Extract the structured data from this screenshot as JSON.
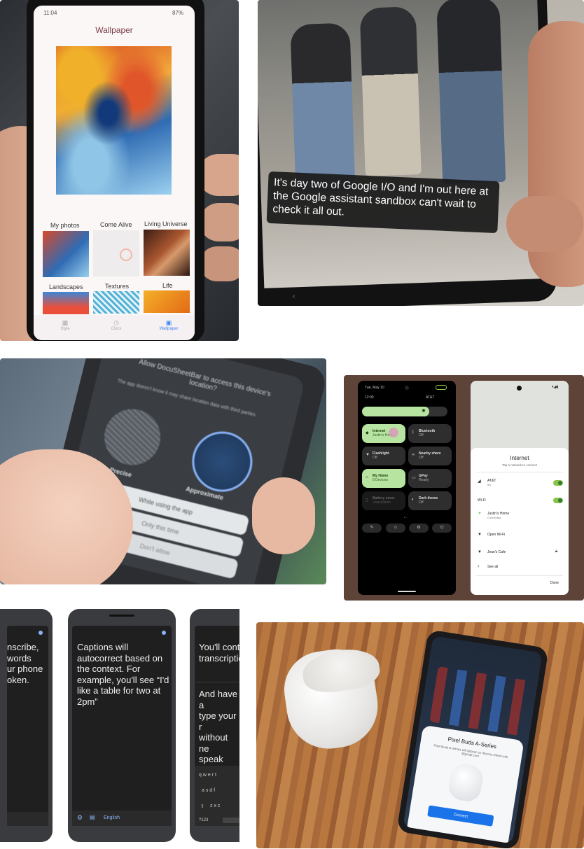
{
  "tile1": {
    "status_time": "11:04",
    "status_battery": "87%",
    "title": "Wallpaper",
    "categories": [
      "My photos",
      "Come Alive",
      "Living Universe",
      "Landscapes",
      "Textures",
      "Life"
    ],
    "nav": [
      "Style",
      "Clock",
      "Wallpaper"
    ]
  },
  "tile2": {
    "caption": "It's day two of Google I/O and I'm out here at the Google assistant sandbox can't wait to check it all out."
  },
  "tile3": {
    "dialog_title": "Allow DocuSheetBar to access this device's location?",
    "dialog_note": "The app doesn't know it may share location data with third parties",
    "precise": "Precise",
    "approximate": "Approximate",
    "options": [
      "While using the app",
      "Only this time",
      "Don't allow"
    ]
  },
  "tile4": {
    "left": {
      "date": "Tue, May 10",
      "time": "12:00",
      "carrier": "AT&T",
      "tiles": [
        {
          "title": "Internet",
          "sub": "Justin's Home"
        },
        {
          "title": "Bluetooth",
          "sub": "Off"
        },
        {
          "title": "Flashlight",
          "sub": "Off"
        },
        {
          "title": "Nearby share",
          "sub": "Off"
        },
        {
          "title": "My Home",
          "sub": "6 Devices"
        },
        {
          "title": "GPay",
          "sub": "Ready"
        },
        {
          "title": "Battery saver",
          "sub": "Unavailable"
        },
        {
          "title": "Dark theme",
          "sub": "Off"
        }
      ]
    },
    "right": {
      "title": "Internet",
      "subtitle": "Tap a network to connect",
      "att": "AT&T",
      "att_sub": "5G",
      "wifi": "Wi-Fi",
      "networks": [
        {
          "name": "Justin's Home",
          "sub": "Connected"
        },
        {
          "name": "Open Wi-Fi",
          "sub": ""
        },
        {
          "name": "Jean's Cafe",
          "sub": ""
        }
      ],
      "see_all": "See all",
      "done": "Done"
    }
  },
  "tile5": {
    "phone1": "nscribe,\nwords\nur phone\noken.",
    "phone2": "Captions will\nautocorrect based on\nthe context. For\nexample, you'll see “I'd\nlike a table for two at\n2pm”",
    "phone2_lang": "English",
    "phone3_top": "You'll cont\ntranscriptio",
    "phone3_bottom": "And have a\ntype your r\nwithout ne\nspeak alou",
    "kb_row1": "q  w  e  r  t",
    "kb_row2": "a  s  d  f",
    "kb_row3": "z  x  c",
    "kb_num": "?123"
  },
  "tile6": {
    "card_title": "Pixel Buds A-Series",
    "card_text": "Pixel Buds A-Series will appear on devices linked with @gmail.com",
    "connect": "Connect"
  },
  "colors": {
    "wallpaper_accent": "#4285f4",
    "qs_active": "#b7e4a1",
    "brown_bg": "#5e4339",
    "connect_blue": "#1a73e8"
  }
}
